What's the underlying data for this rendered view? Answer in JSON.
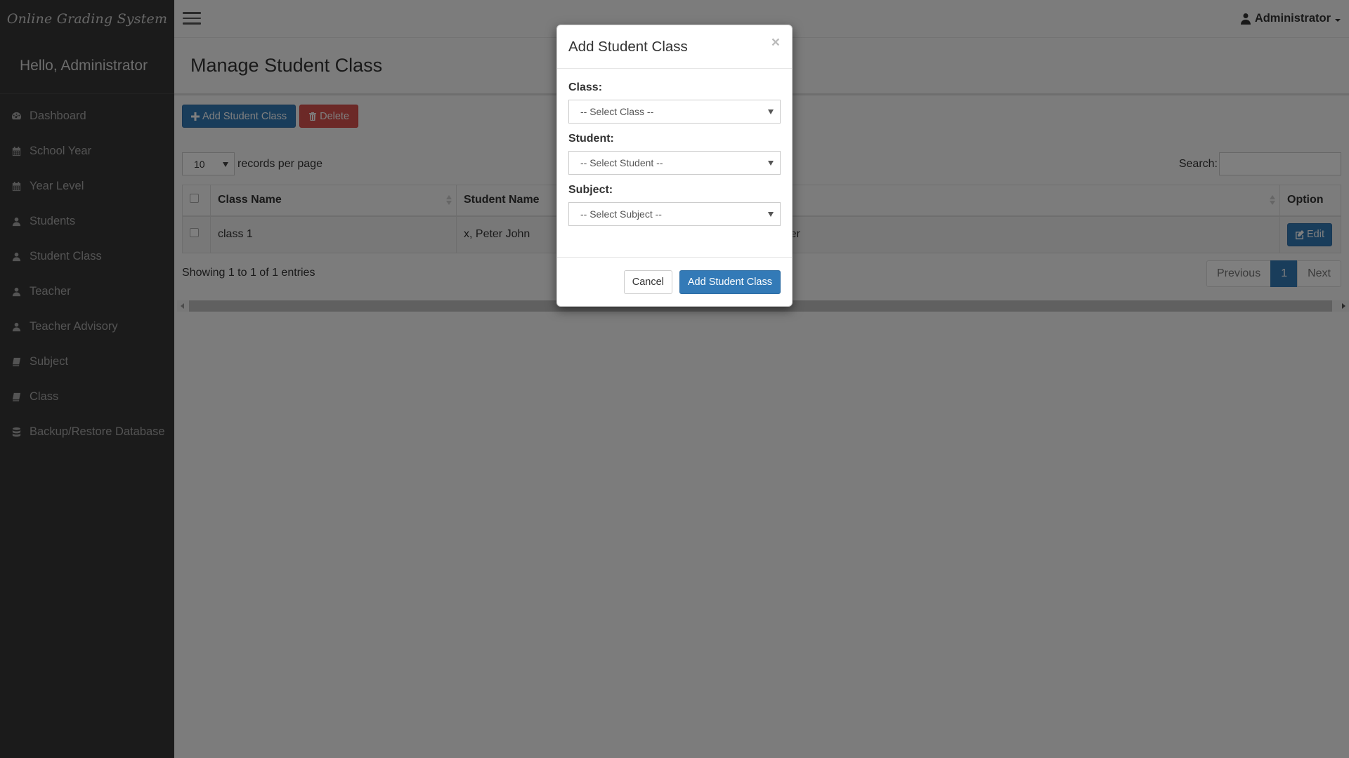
{
  "app": {
    "brand": "Online Grading System",
    "greeting": "Hello, Administrator"
  },
  "sidebar": {
    "items": [
      {
        "label": "Dashboard",
        "icon": "dashboard-icon"
      },
      {
        "label": "School Year",
        "icon": "calendar-icon"
      },
      {
        "label": "Year Level",
        "icon": "calendar-icon"
      },
      {
        "label": "Students",
        "icon": "user-icon"
      },
      {
        "label": "Student Class",
        "icon": "user-icon"
      },
      {
        "label": "Teacher",
        "icon": "user-icon"
      },
      {
        "label": "Teacher Advisory",
        "icon": "user-icon"
      },
      {
        "label": "Subject",
        "icon": "book-icon"
      },
      {
        "label": "Class",
        "icon": "book-icon"
      },
      {
        "label": "Backup/Restore Database",
        "icon": "database-icon"
      }
    ]
  },
  "topbar": {
    "user": "Administrator"
  },
  "page": {
    "title": "Manage Student Class",
    "add_button": "Add Student Class",
    "delete_button": "Delete",
    "length_value": "10",
    "length_suffix": "records per page",
    "search_label": "Search:",
    "search_value": ""
  },
  "table": {
    "columns": [
      "Class Name",
      "Student Name",
      "",
      "Option"
    ],
    "rows": [
      {
        "class_name": "class 1",
        "student_name": "x, Peter John",
        "subject": "Fundamentals of Computer",
        "subject_visible": "amentals of Computer",
        "option": "Edit"
      }
    ],
    "info": "Showing 1 to 1 of 1 entries",
    "pagination": {
      "previous": "Previous",
      "current": "1",
      "next": "Next"
    }
  },
  "modal": {
    "title": "Add Student Class",
    "close": "×",
    "fields": [
      {
        "label": "Class:",
        "placeholder": "-- Select Class --"
      },
      {
        "label": "Student:",
        "placeholder": "-- Select Student --"
      },
      {
        "label": "Subject:",
        "placeholder": "-- Select Subject --"
      }
    ],
    "cancel": "Cancel",
    "submit": "Add Student Class"
  },
  "colors": {
    "primary": "#337ab7",
    "danger": "#d9534f",
    "sidebar_bg": "#363636"
  }
}
